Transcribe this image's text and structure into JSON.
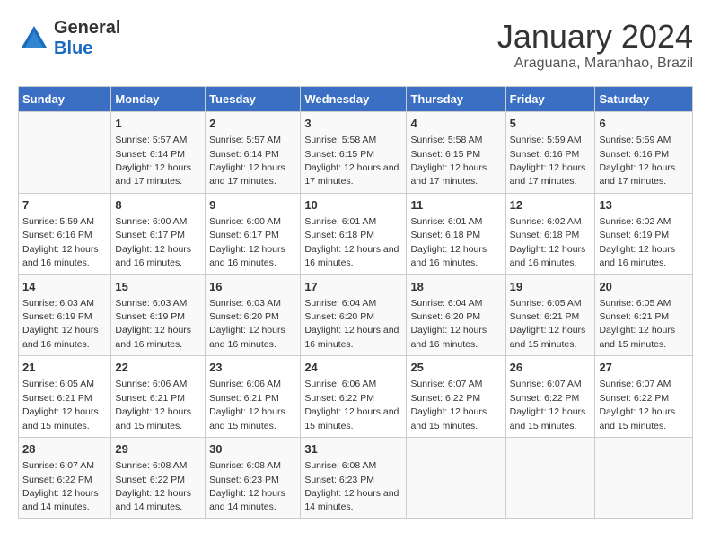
{
  "header": {
    "logo_line1": "General",
    "logo_line2": "Blue",
    "month": "January 2024",
    "location": "Araguana, Maranhao, Brazil"
  },
  "weekdays": [
    "Sunday",
    "Monday",
    "Tuesday",
    "Wednesday",
    "Thursday",
    "Friday",
    "Saturday"
  ],
  "weeks": [
    [
      {
        "day": "",
        "sunrise": "",
        "sunset": "",
        "daylight": ""
      },
      {
        "day": "1",
        "sunrise": "Sunrise: 5:57 AM",
        "sunset": "Sunset: 6:14 PM",
        "daylight": "Daylight: 12 hours and 17 minutes."
      },
      {
        "day": "2",
        "sunrise": "Sunrise: 5:57 AM",
        "sunset": "Sunset: 6:14 PM",
        "daylight": "Daylight: 12 hours and 17 minutes."
      },
      {
        "day": "3",
        "sunrise": "Sunrise: 5:58 AM",
        "sunset": "Sunset: 6:15 PM",
        "daylight": "Daylight: 12 hours and 17 minutes."
      },
      {
        "day": "4",
        "sunrise": "Sunrise: 5:58 AM",
        "sunset": "Sunset: 6:15 PM",
        "daylight": "Daylight: 12 hours and 17 minutes."
      },
      {
        "day": "5",
        "sunrise": "Sunrise: 5:59 AM",
        "sunset": "Sunset: 6:16 PM",
        "daylight": "Daylight: 12 hours and 17 minutes."
      },
      {
        "day": "6",
        "sunrise": "Sunrise: 5:59 AM",
        "sunset": "Sunset: 6:16 PM",
        "daylight": "Daylight: 12 hours and 17 minutes."
      }
    ],
    [
      {
        "day": "7",
        "sunrise": "Sunrise: 5:59 AM",
        "sunset": "Sunset: 6:16 PM",
        "daylight": "Daylight: 12 hours and 16 minutes."
      },
      {
        "day": "8",
        "sunrise": "Sunrise: 6:00 AM",
        "sunset": "Sunset: 6:17 PM",
        "daylight": "Daylight: 12 hours and 16 minutes."
      },
      {
        "day": "9",
        "sunrise": "Sunrise: 6:00 AM",
        "sunset": "Sunset: 6:17 PM",
        "daylight": "Daylight: 12 hours and 16 minutes."
      },
      {
        "day": "10",
        "sunrise": "Sunrise: 6:01 AM",
        "sunset": "Sunset: 6:18 PM",
        "daylight": "Daylight: 12 hours and 16 minutes."
      },
      {
        "day": "11",
        "sunrise": "Sunrise: 6:01 AM",
        "sunset": "Sunset: 6:18 PM",
        "daylight": "Daylight: 12 hours and 16 minutes."
      },
      {
        "day": "12",
        "sunrise": "Sunrise: 6:02 AM",
        "sunset": "Sunset: 6:18 PM",
        "daylight": "Daylight: 12 hours and 16 minutes."
      },
      {
        "day": "13",
        "sunrise": "Sunrise: 6:02 AM",
        "sunset": "Sunset: 6:19 PM",
        "daylight": "Daylight: 12 hours and 16 minutes."
      }
    ],
    [
      {
        "day": "14",
        "sunrise": "Sunrise: 6:03 AM",
        "sunset": "Sunset: 6:19 PM",
        "daylight": "Daylight: 12 hours and 16 minutes."
      },
      {
        "day": "15",
        "sunrise": "Sunrise: 6:03 AM",
        "sunset": "Sunset: 6:19 PM",
        "daylight": "Daylight: 12 hours and 16 minutes."
      },
      {
        "day": "16",
        "sunrise": "Sunrise: 6:03 AM",
        "sunset": "Sunset: 6:20 PM",
        "daylight": "Daylight: 12 hours and 16 minutes."
      },
      {
        "day": "17",
        "sunrise": "Sunrise: 6:04 AM",
        "sunset": "Sunset: 6:20 PM",
        "daylight": "Daylight: 12 hours and 16 minutes."
      },
      {
        "day": "18",
        "sunrise": "Sunrise: 6:04 AM",
        "sunset": "Sunset: 6:20 PM",
        "daylight": "Daylight: 12 hours and 16 minutes."
      },
      {
        "day": "19",
        "sunrise": "Sunrise: 6:05 AM",
        "sunset": "Sunset: 6:21 PM",
        "daylight": "Daylight: 12 hours and 15 minutes."
      },
      {
        "day": "20",
        "sunrise": "Sunrise: 6:05 AM",
        "sunset": "Sunset: 6:21 PM",
        "daylight": "Daylight: 12 hours and 15 minutes."
      }
    ],
    [
      {
        "day": "21",
        "sunrise": "Sunrise: 6:05 AM",
        "sunset": "Sunset: 6:21 PM",
        "daylight": "Daylight: 12 hours and 15 minutes."
      },
      {
        "day": "22",
        "sunrise": "Sunrise: 6:06 AM",
        "sunset": "Sunset: 6:21 PM",
        "daylight": "Daylight: 12 hours and 15 minutes."
      },
      {
        "day": "23",
        "sunrise": "Sunrise: 6:06 AM",
        "sunset": "Sunset: 6:21 PM",
        "daylight": "Daylight: 12 hours and 15 minutes."
      },
      {
        "day": "24",
        "sunrise": "Sunrise: 6:06 AM",
        "sunset": "Sunset: 6:22 PM",
        "daylight": "Daylight: 12 hours and 15 minutes."
      },
      {
        "day": "25",
        "sunrise": "Sunrise: 6:07 AM",
        "sunset": "Sunset: 6:22 PM",
        "daylight": "Daylight: 12 hours and 15 minutes."
      },
      {
        "day": "26",
        "sunrise": "Sunrise: 6:07 AM",
        "sunset": "Sunset: 6:22 PM",
        "daylight": "Daylight: 12 hours and 15 minutes."
      },
      {
        "day": "27",
        "sunrise": "Sunrise: 6:07 AM",
        "sunset": "Sunset: 6:22 PM",
        "daylight": "Daylight: 12 hours and 15 minutes."
      }
    ],
    [
      {
        "day": "28",
        "sunrise": "Sunrise: 6:07 AM",
        "sunset": "Sunset: 6:22 PM",
        "daylight": "Daylight: 12 hours and 14 minutes."
      },
      {
        "day": "29",
        "sunrise": "Sunrise: 6:08 AM",
        "sunset": "Sunset: 6:22 PM",
        "daylight": "Daylight: 12 hours and 14 minutes."
      },
      {
        "day": "30",
        "sunrise": "Sunrise: 6:08 AM",
        "sunset": "Sunset: 6:23 PM",
        "daylight": "Daylight: 12 hours and 14 minutes."
      },
      {
        "day": "31",
        "sunrise": "Sunrise: 6:08 AM",
        "sunset": "Sunset: 6:23 PM",
        "daylight": "Daylight: 12 hours and 14 minutes."
      },
      {
        "day": "",
        "sunrise": "",
        "sunset": "",
        "daylight": ""
      },
      {
        "day": "",
        "sunrise": "",
        "sunset": "",
        "daylight": ""
      },
      {
        "day": "",
        "sunrise": "",
        "sunset": "",
        "daylight": ""
      }
    ]
  ]
}
